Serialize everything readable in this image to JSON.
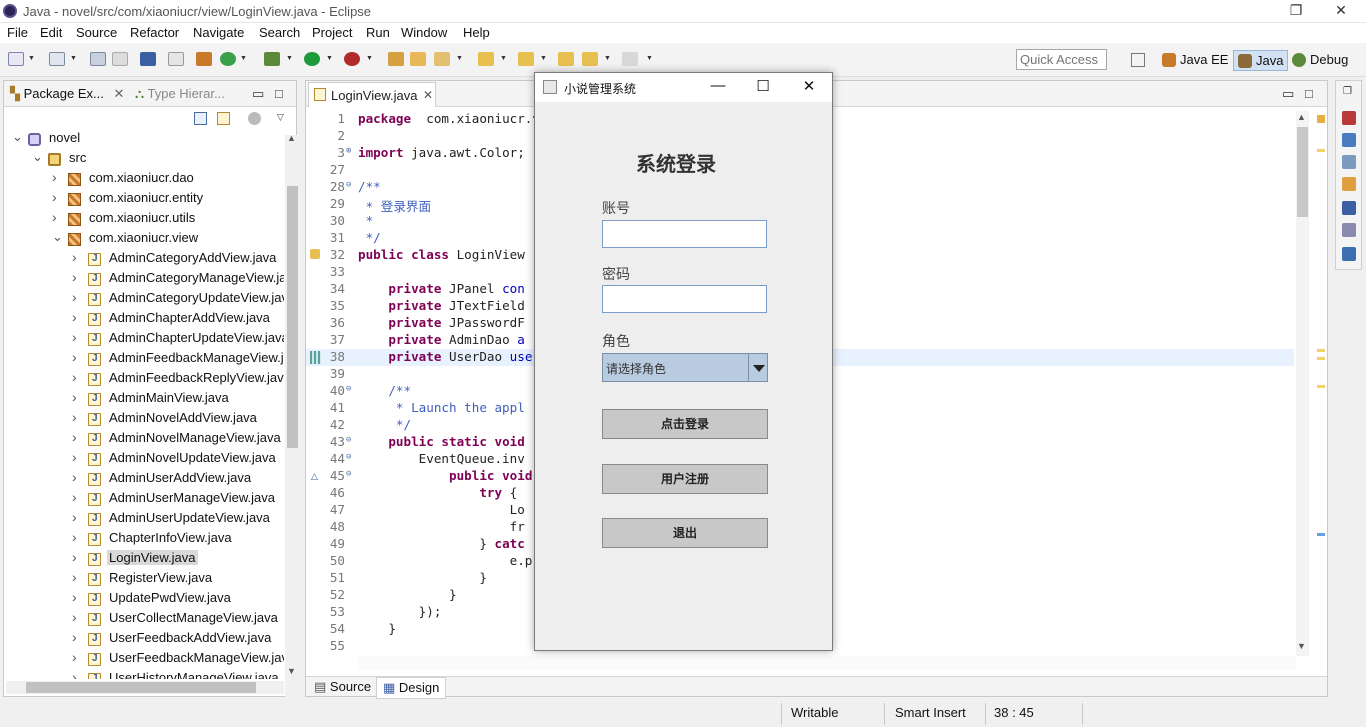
{
  "window": {
    "title": "Java - novel/src/com/xiaoniucr/view/LoginView.java - Eclipse"
  },
  "menu": [
    "File",
    "Edit",
    "Source",
    "Refactor",
    "Navigate",
    "Search",
    "Project",
    "Run",
    "Window",
    "Help"
  ],
  "quick_access": {
    "placeholder": "Quick Access"
  },
  "perspectives": [
    {
      "label": "Java EE",
      "icon": "java-ee-perspective-icon"
    },
    {
      "label": "Java",
      "icon": "java-perspective-icon",
      "active": true
    },
    {
      "label": "Debug",
      "icon": "debug-perspective-icon"
    }
  ],
  "package_explorer": {
    "tab_active": "Package Ex...",
    "tab_inactive": "Type Hierar...",
    "tree": [
      {
        "label": "novel",
        "level": 0,
        "icon": "project-icon",
        "twisty": "open"
      },
      {
        "label": "src",
        "level": 1,
        "icon": "source-folder-icon",
        "twisty": "open"
      },
      {
        "label": "com.xiaoniucr.dao",
        "level": 2,
        "icon": "package-icon",
        "twisty": "closed"
      },
      {
        "label": "com.xiaoniucr.entity",
        "level": 2,
        "icon": "package-icon",
        "twisty": "closed"
      },
      {
        "label": "com.xiaoniucr.utils",
        "level": 2,
        "icon": "package-icon",
        "twisty": "closed"
      },
      {
        "label": "com.xiaoniucr.view",
        "level": 2,
        "icon": "package-icon",
        "twisty": "open"
      },
      {
        "label": "AdminCategoryAddView.java",
        "level": 3,
        "icon": "java-file-icon",
        "twisty": "closed"
      },
      {
        "label": "AdminCategoryManageView.ja",
        "level": 3,
        "icon": "java-file-icon",
        "twisty": "closed"
      },
      {
        "label": "AdminCategoryUpdateView.jav",
        "level": 3,
        "icon": "java-file-icon",
        "twisty": "closed"
      },
      {
        "label": "AdminChapterAddView.java",
        "level": 3,
        "icon": "java-file-icon",
        "twisty": "closed"
      },
      {
        "label": "AdminChapterUpdateView.java",
        "level": 3,
        "icon": "java-file-icon",
        "twisty": "closed"
      },
      {
        "label": "AdminFeedbackManageView.j",
        "level": 3,
        "icon": "java-file-icon",
        "twisty": "closed"
      },
      {
        "label": "AdminFeedbackReplyView.java",
        "level": 3,
        "icon": "java-file-icon",
        "twisty": "closed"
      },
      {
        "label": "AdminMainView.java",
        "level": 3,
        "icon": "java-file-icon",
        "twisty": "closed"
      },
      {
        "label": "AdminNovelAddView.java",
        "level": 3,
        "icon": "java-file-icon",
        "twisty": "closed"
      },
      {
        "label": "AdminNovelManageView.java",
        "level": 3,
        "icon": "java-file-icon",
        "twisty": "closed"
      },
      {
        "label": "AdminNovelUpdateView.java",
        "level": 3,
        "icon": "java-file-icon",
        "twisty": "closed"
      },
      {
        "label": "AdminUserAddView.java",
        "level": 3,
        "icon": "java-file-icon",
        "twisty": "closed"
      },
      {
        "label": "AdminUserManageView.java",
        "level": 3,
        "icon": "java-file-icon",
        "twisty": "closed"
      },
      {
        "label": "AdminUserUpdateView.java",
        "level": 3,
        "icon": "java-file-icon",
        "twisty": "closed"
      },
      {
        "label": "ChapterInfoView.java",
        "level": 3,
        "icon": "java-file-icon",
        "twisty": "closed"
      },
      {
        "label": "LoginView.java",
        "level": 3,
        "icon": "java-file-icon",
        "twisty": "closed",
        "selected": true
      },
      {
        "label": "RegisterView.java",
        "level": 3,
        "icon": "java-file-icon",
        "twisty": "closed"
      },
      {
        "label": "UpdatePwdView.java",
        "level": 3,
        "icon": "java-file-icon",
        "twisty": "closed"
      },
      {
        "label": "UserCollectManageView.java",
        "level": 3,
        "icon": "java-file-icon",
        "twisty": "closed"
      },
      {
        "label": "UserFeedbackAddView.java",
        "level": 3,
        "icon": "java-file-icon",
        "twisty": "closed"
      },
      {
        "label": "UserFeedbackManageView.jav",
        "level": 3,
        "icon": "java-file-icon",
        "twisty": "closed"
      },
      {
        "label": "UserHistoryManageView.java",
        "level": 3,
        "icon": "java-file-icon",
        "twisty": "closed"
      }
    ]
  },
  "editor": {
    "tab_label": "LoginView.java",
    "bottom_tabs": [
      "Source",
      "Design"
    ],
    "lines": [
      {
        "n": "1",
        "segs": [
          [
            "kw",
            "package"
          ],
          [
            "",
            "  com.xiaoniucr.v"
          ]
        ]
      },
      {
        "n": "2",
        "segs": []
      },
      {
        "n": "3",
        "fold": "+",
        "segs": [
          [
            "kw",
            "import"
          ],
          [
            "",
            " java.awt.Color;"
          ]
        ]
      },
      {
        "n": "27",
        "segs": []
      },
      {
        "n": "28",
        "fold": "-",
        "segs": [
          [
            "cm",
            "/**"
          ]
        ]
      },
      {
        "n": "29",
        "segs": [
          [
            "cm",
            " * 登录界面"
          ]
        ]
      },
      {
        "n": "30",
        "segs": [
          [
            "cm",
            " *"
          ]
        ]
      },
      {
        "n": "31",
        "segs": [
          [
            "cm",
            " */"
          ]
        ]
      },
      {
        "n": "32",
        "segs": [
          [
            "kw",
            "public class"
          ],
          [
            "",
            " LoginView"
          ]
        ]
      },
      {
        "n": "33",
        "segs": []
      },
      {
        "n": "34",
        "segs": [
          [
            "",
            "    "
          ],
          [
            "kw",
            "private"
          ],
          [
            "",
            " JPanel "
          ],
          [
            "fld",
            "con"
          ]
        ]
      },
      {
        "n": "35",
        "segs": [
          [
            "",
            "    "
          ],
          [
            "kw",
            "private"
          ],
          [
            "",
            " JTextField"
          ]
        ]
      },
      {
        "n": "36",
        "segs": [
          [
            "",
            "    "
          ],
          [
            "kw",
            "private"
          ],
          [
            "",
            " JPasswordF"
          ]
        ]
      },
      {
        "n": "37",
        "segs": [
          [
            "",
            "    "
          ],
          [
            "kw",
            "private"
          ],
          [
            "",
            " AdminDao "
          ],
          [
            "fld",
            "a"
          ]
        ]
      },
      {
        "n": "38",
        "current": true,
        "segs": [
          [
            "",
            "    "
          ],
          [
            "kw",
            "private"
          ],
          [
            "",
            " UserDao "
          ],
          [
            "fld",
            "use"
          ]
        ]
      },
      {
        "n": "39",
        "segs": []
      },
      {
        "n": "40",
        "fold": "-",
        "segs": [
          [
            "cm",
            "    /**"
          ]
        ]
      },
      {
        "n": "41",
        "segs": [
          [
            "cm",
            "     * Launch the appl"
          ]
        ]
      },
      {
        "n": "42",
        "segs": [
          [
            "cm",
            "     */"
          ]
        ]
      },
      {
        "n": "43",
        "fold": "-",
        "segs": [
          [
            "",
            "    "
          ],
          [
            "kw",
            "public static void"
          ]
        ]
      },
      {
        "n": "44",
        "fold": "-",
        "segs": [
          [
            "",
            "        EventQueue.inv"
          ]
        ]
      },
      {
        "n": "45",
        "fold": "-",
        "segs": [
          [
            "",
            "            "
          ],
          [
            "kw",
            "public void"
          ]
        ]
      },
      {
        "n": "46",
        "segs": [
          [
            "",
            "                "
          ],
          [
            "kw",
            "try"
          ],
          [
            "",
            " {"
          ]
        ]
      },
      {
        "n": "47",
        "segs": [
          [
            "",
            "                    Lo"
          ]
        ]
      },
      {
        "n": "48",
        "segs": [
          [
            "",
            "                    fr"
          ]
        ]
      },
      {
        "n": "49",
        "segs": [
          [
            "",
            "                } "
          ],
          [
            "kw",
            "catc"
          ]
        ]
      },
      {
        "n": "50",
        "segs": [
          [
            "",
            "                    e.p"
          ]
        ]
      },
      {
        "n": "51",
        "segs": [
          [
            "",
            "                }"
          ]
        ]
      },
      {
        "n": "52",
        "segs": [
          [
            "",
            "            }"
          ]
        ]
      },
      {
        "n": "53",
        "segs": [
          [
            "",
            "        });"
          ]
        ]
      },
      {
        "n": "54",
        "segs": [
          [
            "",
            "    }"
          ]
        ]
      },
      {
        "n": "55",
        "segs": []
      }
    ]
  },
  "status": {
    "writable": "Writable",
    "insert_mode": "Smart Insert",
    "position": "38 : 45"
  },
  "dialog": {
    "title": "小说管理系统",
    "heading": "系统登录",
    "account_label": "账号",
    "account_value": "",
    "password_label": "密码",
    "password_value": "",
    "role_label": "角色",
    "role_selected": "请选择角色",
    "login_button": "点击登录",
    "register_button": "用户注册",
    "exit_button": "退出"
  }
}
